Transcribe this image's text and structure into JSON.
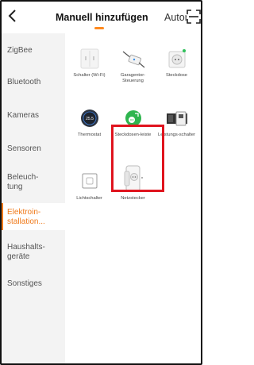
{
  "header": {
    "back_icon": "back-chevron-icon",
    "tabs": [
      {
        "label": "Manuell hinzufügen",
        "active": true
      },
      {
        "label": "Autom",
        "active": false
      }
    ],
    "scan_icon": "scan-icon",
    "accent": "#ff8a1f"
  },
  "sidebar": {
    "items": [
      {
        "label": "ZigBee",
        "active": false
      },
      {
        "label": "Bluetooth",
        "active": false
      },
      {
        "label": "Kameras",
        "active": false
      },
      {
        "label": "Sensoren",
        "active": false
      },
      {
        "label": "Beleuch-tung",
        "active": false
      },
      {
        "label": "Elektroin-stallation...",
        "active": true
      },
      {
        "label": "Haushalts-geräte",
        "active": false
      },
      {
        "label": "Sonstiges",
        "active": false
      }
    ],
    "active_color": "#f07a1a"
  },
  "devices": [
    {
      "label": "Schalter (Wi-Fi)",
      "icon": "wall-switch-icon"
    },
    {
      "label": "Garagentor-Steuerung",
      "icon": "garage-controller-icon"
    },
    {
      "label": "Steckdose",
      "icon": "socket-icon"
    },
    {
      "label": "Thermostat",
      "icon": "thermostat-icon"
    },
    {
      "label": "Steckdosen-leiste",
      "icon": "power-strip-icon"
    },
    {
      "label": "Leistungs-schalter",
      "icon": "circuit-breaker-icon"
    },
    {
      "label": "Lichtschalter",
      "icon": "light-switch-icon"
    },
    {
      "label": "Netzstecker",
      "icon": "smart-plug-icon",
      "highlighted": true
    }
  ],
  "highlight_color": "#e0141e"
}
